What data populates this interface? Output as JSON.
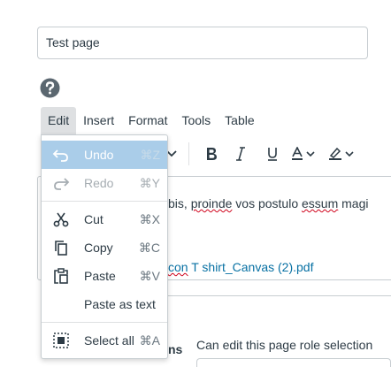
{
  "page_title_value": "Test page",
  "menubar": {
    "items": [
      "Edit",
      "Insert",
      "Format",
      "Tools",
      "Table"
    ]
  },
  "edit_menu": {
    "undo": {
      "label": "Undo",
      "shortcut": "⌘Z"
    },
    "redo": {
      "label": "Redo",
      "shortcut": "⌘Y"
    },
    "cut": {
      "label": "Cut",
      "shortcut": "⌘X"
    },
    "copy": {
      "label": "Copy",
      "shortcut": "⌘C"
    },
    "paste": {
      "label": "Paste",
      "shortcut": "⌘V"
    },
    "paste_as_text": {
      "label": "Paste as text"
    },
    "select_all": {
      "label": "Select all",
      "shortcut": "⌘A"
    }
  },
  "editor": {
    "text_before": "bis, ",
    "text_spell1": "proinde",
    "text_middle": " vos postulo ",
    "text_spell2": "essum",
    "text_after": " magi",
    "link_spell": "con",
    "link_rest": " T shirt_Canvas (2).pdf"
  },
  "permissions": {
    "label_suffix": "ns",
    "can_edit_label": "Can edit this page role selection"
  },
  "colors": {
    "highlight": "#aacde9",
    "link": "#0770a3",
    "text": "#2d3b45"
  }
}
